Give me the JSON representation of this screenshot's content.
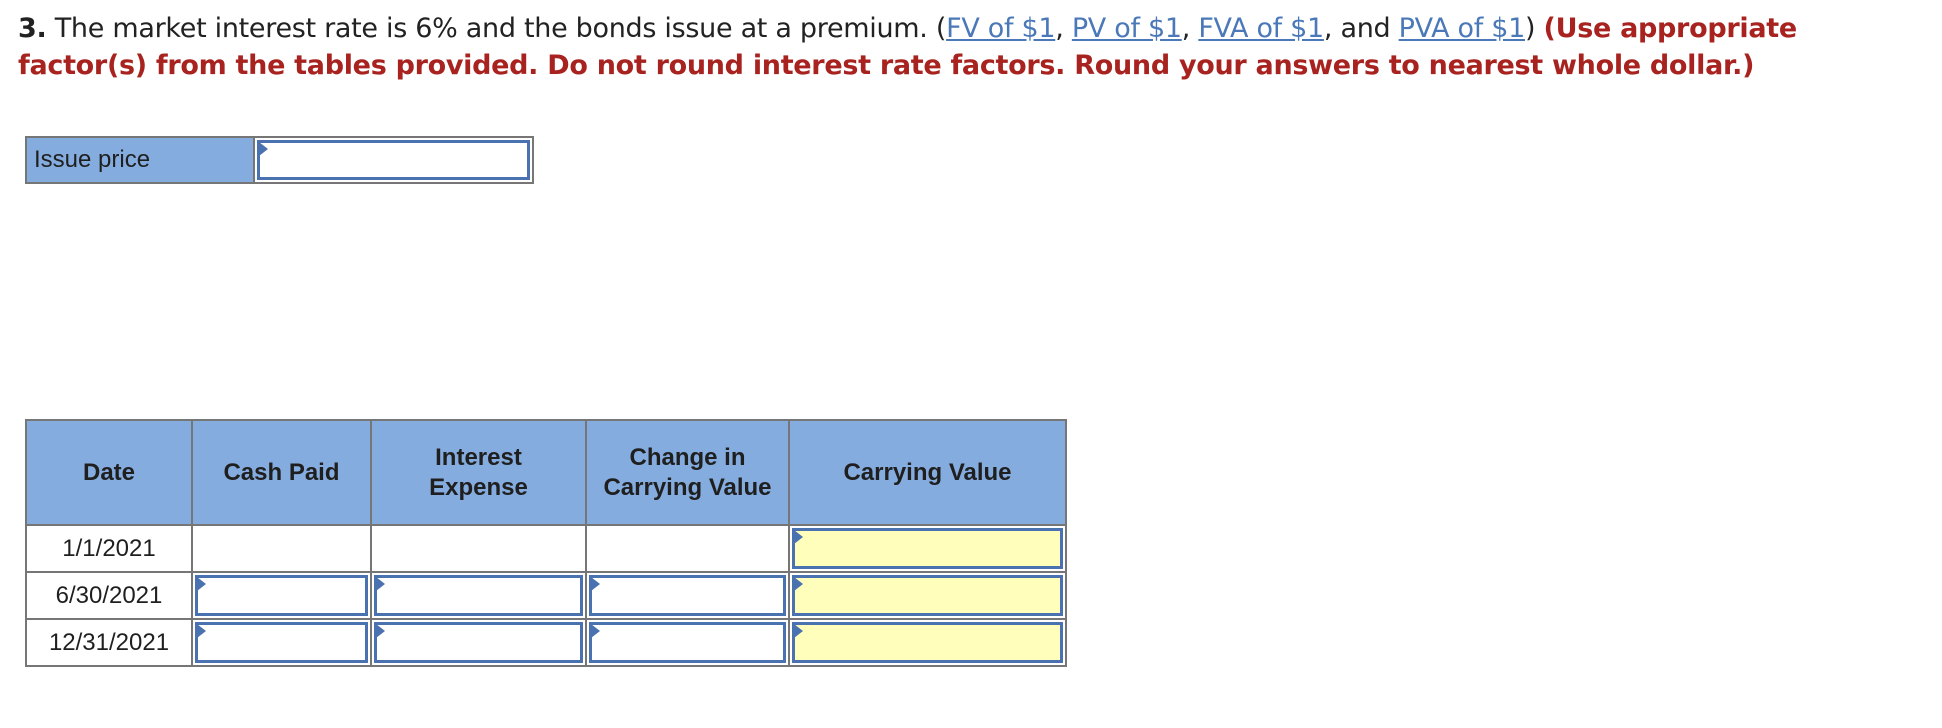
{
  "question": {
    "number": "3.",
    "text": " The market interest rate is 6% and the bonds issue at a premium. (",
    "links": [
      "FV of $1",
      "PV of $1",
      "FVA of $1",
      "PVA of $1"
    ],
    "sep1": ", ",
    "sep2": ", ",
    "sep3": ", and ",
    "close": ") ",
    "instructions": "(Use appropriate factor(s) from the tables provided. Do not round interest rate factors. Round your answers to nearest whole dollar.)"
  },
  "issue_price": {
    "label": "Issue price",
    "value": ""
  },
  "schedule": {
    "headers": [
      "Date",
      "Cash Paid",
      "Interest Expense",
      "Change in Carrying Value",
      "Carrying Value"
    ],
    "rows": [
      {
        "date": "1/1/2021",
        "cash_paid": "",
        "interest_expense": "",
        "change": "",
        "carrying_value": ""
      },
      {
        "date": "6/30/2021",
        "cash_paid": "",
        "interest_expense": "",
        "change": "",
        "carrying_value": ""
      },
      {
        "date": "12/31/2021",
        "cash_paid": "",
        "interest_expense": "",
        "change": "",
        "carrying_value": ""
      }
    ]
  },
  "colors": {
    "header_bg": "#84acdf",
    "input_border": "#4a72b0",
    "highlight_bg": "#ffffbb",
    "instruction_red": "#a8231f",
    "link_blue": "#4a78b8"
  }
}
